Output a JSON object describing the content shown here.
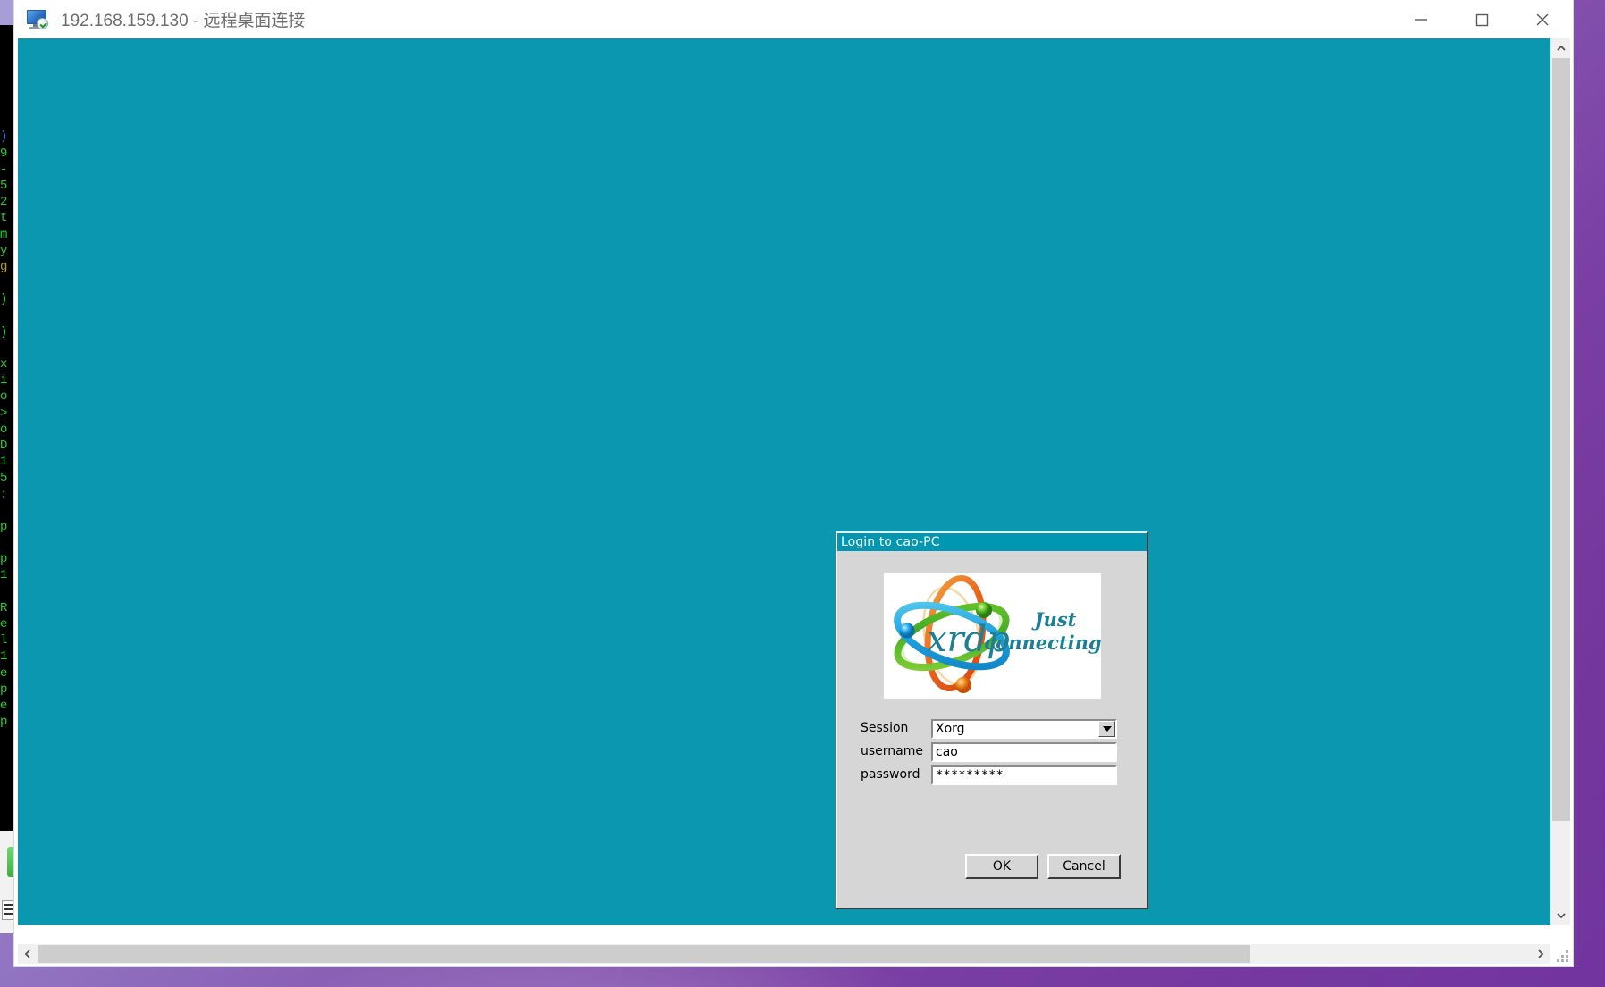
{
  "desktop": {
    "wallpaper_color": "#7a3fa4"
  },
  "background_terminal": {
    "visible_sliver_lines": [
      ")",
      "9",
      "-",
      "5",
      "2",
      "t",
      "m",
      "y",
      "g",
      "",
      ")",
      "",
      ")",
      "",
      "x",
      "i",
      "o",
      ">",
      "o",
      "D",
      "1",
      "5",
      ":",
      "",
      "p",
      "",
      "p",
      "1",
      "",
      "R",
      "e",
      "l",
      "1",
      "e",
      "p",
      "e",
      "p"
    ],
    "text_color": "#24d024",
    "background_color": "#000000"
  },
  "rdp_window": {
    "title": "192.168.159.130 - 远程桌面连接",
    "icon": "remote-desktop-icon",
    "controls": {
      "minimize_label": "最小化",
      "maximize_label": "最大化",
      "close_label": "关闭"
    },
    "canvas_color": "#0b97b0",
    "scrollbars": {
      "vertical_up_icon": "chevron-up-icon",
      "vertical_down_icon": "chevron-down-icon",
      "horizontal_left_icon": "chevron-left-icon",
      "horizontal_right_icon": "chevron-right-icon",
      "grip_icon": "resize-grip-icon"
    }
  },
  "xrdp_dialog": {
    "title": "Login to cao-PC",
    "title_bar_color": "#0097b2",
    "logo": {
      "wordmark": "xrdp",
      "tagline_line1": "Just",
      "tagline_line2": "connecting",
      "tagline_color": "#1b7f96",
      "ring_colors": [
        "#e8631b",
        "#5fbf1f",
        "#1fa8e0"
      ],
      "node_colors": [
        "#1fa8e0",
        "#4fc21f",
        "#f08a1e"
      ]
    },
    "fields": [
      {
        "name": "session",
        "label": "Session",
        "type": "combobox",
        "value": "Xorg",
        "options": [
          "Xorg"
        ]
      },
      {
        "name": "username",
        "label": "username",
        "type": "text",
        "value": "cao",
        "placeholder": ""
      },
      {
        "name": "password",
        "label": "password",
        "type": "password",
        "value": "*********",
        "placeholder": ""
      }
    ],
    "buttons": {
      "ok": "OK",
      "cancel": "Cancel"
    }
  }
}
